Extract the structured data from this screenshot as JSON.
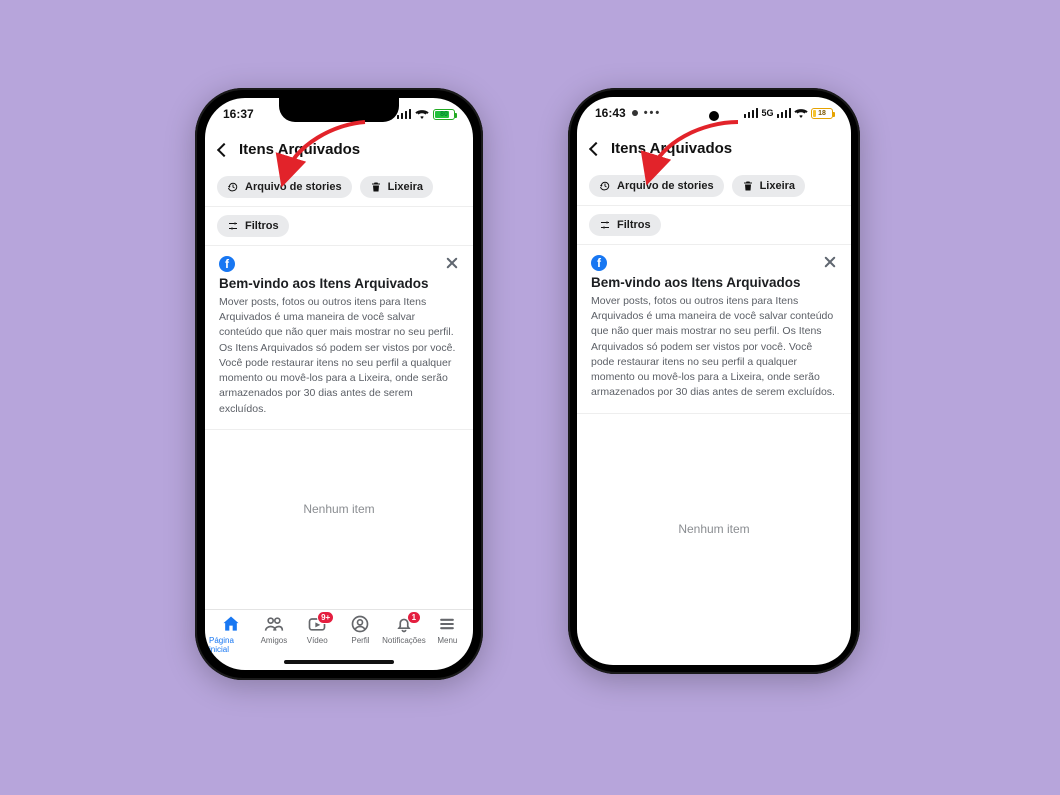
{
  "iphone": {
    "status": {
      "time": "16:37",
      "battery_pct": 80,
      "battery_label": "80"
    },
    "header": {
      "title": "Itens Arquivados"
    },
    "chips": {
      "stories": "Arquivo de stories",
      "trash": "Lixeira",
      "filters": "Filtros"
    },
    "info": {
      "title": "Bem-vindo aos Itens Arquivados",
      "body": "Mover posts, fotos ou outros itens para Itens Arquivados é uma maneira de você salvar conteúdo que não quer mais mostrar no seu perfil. Os Itens Arquivados só podem ser vistos por você. Você pode restaurar itens no seu perfil a qualquer momento ou movê-los para a Lixeira, onde serão armazenados por 30 dias antes de serem excluídos."
    },
    "empty": "Nenhum item",
    "nav": {
      "home": "Página inicial",
      "friends": "Amigos",
      "video": "Vídeo",
      "profile": "Perfil",
      "notifications": "Notificações",
      "menu": "Menu",
      "video_badge": "9+",
      "notif_badge": "1"
    }
  },
  "android": {
    "status": {
      "time": "16:43",
      "battery_pct": 18,
      "battery_label": "18",
      "network": "5G"
    },
    "header": {
      "title": "Itens Arquivados"
    },
    "chips": {
      "stories": "Arquivo de stories",
      "trash": "Lixeira",
      "filters": "Filtros"
    },
    "info": {
      "title": "Bem-vindo aos Itens Arquivados",
      "body": "Mover posts, fotos ou outros itens para Itens Arquivados é uma maneira de você salvar conteúdo que não quer mais mostrar no seu perfil. Os Itens Arquivados só podem ser vistos por você. Você pode restaurar itens no seu perfil a qualquer momento ou movê-los para a Lixeira, onde serão armazenados por 30 dias antes de serem excluídos."
    },
    "empty": "Nenhum item"
  }
}
